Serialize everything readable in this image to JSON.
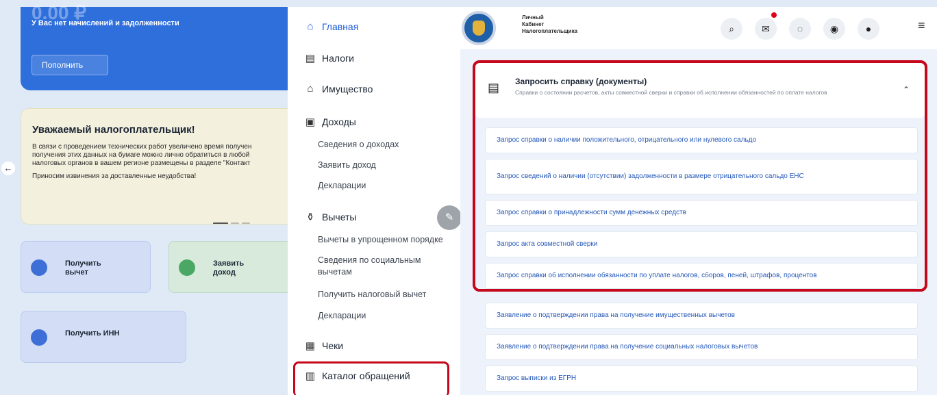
{
  "dashboard": {
    "balance_amount": "0.00 ₽",
    "balance_note": "У Вас нет начислений и задолженности",
    "topup_label": "Пополнить",
    "notice_title": "Уважаемый налогоплательщик!",
    "notice_body": "В связи с проведением технических работ увеличено время получен\nполучения этих данных на бумаге можно лично обратиться в любой\nналоговых органов в вашем регионе размещены в разделе \"Контакт",
    "notice_apology": "Приносим извинения за доставленные неудобства!",
    "tiles": [
      {
        "label": "Получить\nвычет",
        "color": "#3e6fd6"
      },
      {
        "label": "Заявить\nдоход",
        "color": "#4aa864"
      },
      {
        "label": "Получить ИНН",
        "color": "#3e6fd6"
      }
    ]
  },
  "menu": {
    "home": "Главная",
    "taxes": "Налоги",
    "property": "Имущество",
    "income": "Доходы",
    "income_sub": [
      "Сведения о доходах",
      "Заявить доход",
      "Декларации"
    ],
    "deductions": "Вычеты",
    "deductions_sub": [
      "Вычеты в упрощенном порядке",
      "Сведения по социальным\nвычетам",
      "Получить налоговый вычет",
      "Декларации"
    ],
    "receipts": "Чеки",
    "catalog": "Каталог обращений"
  },
  "header": {
    "brand": "Личный\nКабинет\nНалогоплательщика",
    "icons": [
      "search-icon",
      "mail-icon",
      "hide-icon",
      "idea-icon",
      "profile-icon",
      "menu-icon"
    ]
  },
  "section": {
    "title": "Запросить справку (документы)",
    "description": "Справки о состоянии расчетов, акты совместной сверки и справки об исполнении обязанностей по оплате налогов",
    "requests": [
      "Запрос справки о наличии положительного, отрицательного или нулевого сальдо",
      "Запрос сведений о наличии (отсутствии) задолженности в размере отрицательного сальдо ЕНС",
      "Запрос справки о принадлежности сумм денежных средств",
      "Запрос акта совместной сверки",
      "Запрос справки об исполнении обязанности по уплате налогов, сборов, пеней, штрафов, процентов",
      "Заявление о подтверждении права на получение имущественных вычетов",
      "Заявление о подтверждении права на получение социальных налоговых вычетов",
      "Запрос выписки из ЕГРН"
    ]
  },
  "colors": {
    "accent_blue": "#1b5bd9",
    "highlight_red": "#c4071b",
    "link_blue": "#2458b8"
  }
}
